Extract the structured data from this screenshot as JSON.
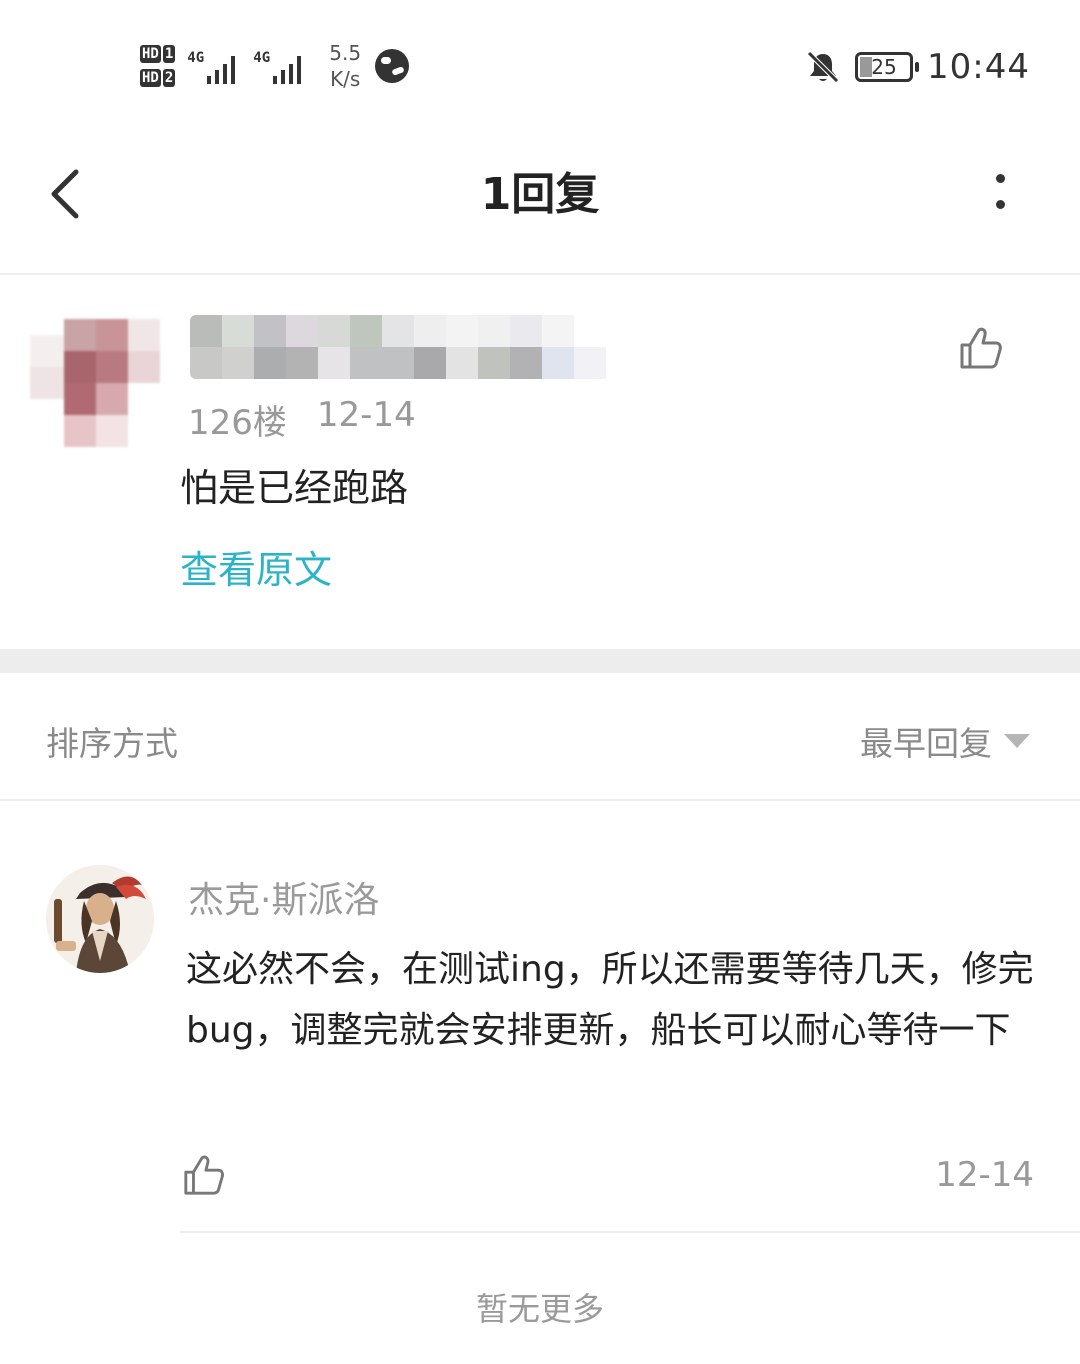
{
  "status_bar": {
    "sim1": "HD",
    "sim1_index": "1",
    "sim2": "HD",
    "sim2_index": "2",
    "network1": "4G",
    "network2": "4G",
    "speed_value": "5.5",
    "speed_unit": "K/s",
    "battery": "25",
    "time": "10:44",
    "icons": [
      "signal-icon",
      "globe-icon",
      "bell-off-icon",
      "battery-icon"
    ]
  },
  "header": {
    "title": "1回复",
    "back_icon": "chevron-left-icon",
    "more_icon": "more-vertical-icon"
  },
  "post": {
    "floor": "126楼",
    "date": "12-14",
    "text": "怕是已经跑路",
    "view_original": "查看原文",
    "like_icon": "thumbs-up-icon"
  },
  "sort": {
    "label": "排序方式",
    "selected": "最早回复"
  },
  "reply": {
    "author": "杰克·斯派洛",
    "text": "这必然不会，在测试ing，所以还需要等待几天，修完bug，调整完就会安排更新，船长可以耐心等待一下",
    "date": "12-14",
    "like_icon": "thumbs-up-icon"
  },
  "footer": {
    "no_more": "暂无更多"
  },
  "colors": {
    "accent": "#2bb3c6",
    "secondary_text": "#999999",
    "divider": "#ededed"
  }
}
